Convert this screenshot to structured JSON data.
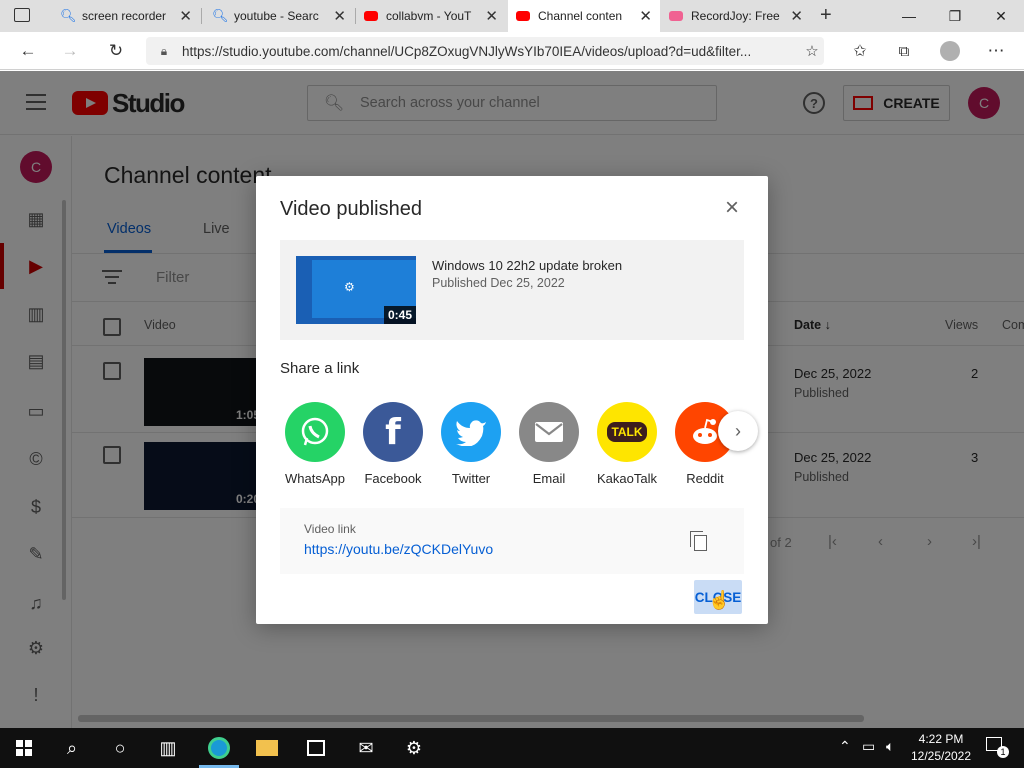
{
  "browser": {
    "tabs": [
      {
        "title": "screen recorder",
        "icon": "search-icon"
      },
      {
        "title": "youtube - Searc",
        "icon": "search-icon"
      },
      {
        "title": "collabvm - YouT",
        "icon": "youtube-icon"
      },
      {
        "title": "Channel conten",
        "icon": "youtube-icon"
      },
      {
        "title": "RecordJoy: Free",
        "icon": "recordjoy-icon"
      }
    ],
    "url": "https://studio.youtube.com/channel/UCp8ZOxugVNJlyWsYIb70IEA/videos/upload?d=ud&filter..."
  },
  "studio": {
    "logo_text": "Studio",
    "search_placeholder": "Search across your channel",
    "create_label": "CREATE",
    "avatar_letter": "C",
    "page_title": "Channel content",
    "tabs": [
      "Videos",
      "Live"
    ],
    "filter_label": "Filter",
    "columns": {
      "video": "Video",
      "date": "Date ↓",
      "views": "Views",
      "comments": "Com"
    },
    "rows": [
      {
        "duration": "1:05",
        "date": "Dec 25, 2022",
        "status": "Published",
        "views": "2"
      },
      {
        "duration": "0:20",
        "date": "Dec 25, 2022",
        "status": "Published",
        "views": "3"
      }
    ],
    "pagination": "of 2"
  },
  "dialog": {
    "title": "Video published",
    "video": {
      "title": "Windows 10 22h2 update broken",
      "subtitle": "Published Dec 25, 2022",
      "duration": "0:45"
    },
    "share_label": "Share a link",
    "share_targets": [
      {
        "label": "WhatsApp",
        "color": "#25d366"
      },
      {
        "label": "Facebook",
        "color": "#3b5998"
      },
      {
        "label": "Twitter",
        "color": "#1da1f2"
      },
      {
        "label": "Email",
        "color": "#888888"
      },
      {
        "label": "KakaoTalk",
        "color": "#fee500",
        "badge": "TALK"
      },
      {
        "label": "Reddit",
        "color": "#ff4500"
      }
    ],
    "link_label": "Video link",
    "link_url": "https://youtu.be/zQCKDelYuvo",
    "close_label": "CLOSE"
  },
  "taskbar": {
    "time": "4:22 PM",
    "date": "12/25/2022",
    "notifications": "1"
  }
}
